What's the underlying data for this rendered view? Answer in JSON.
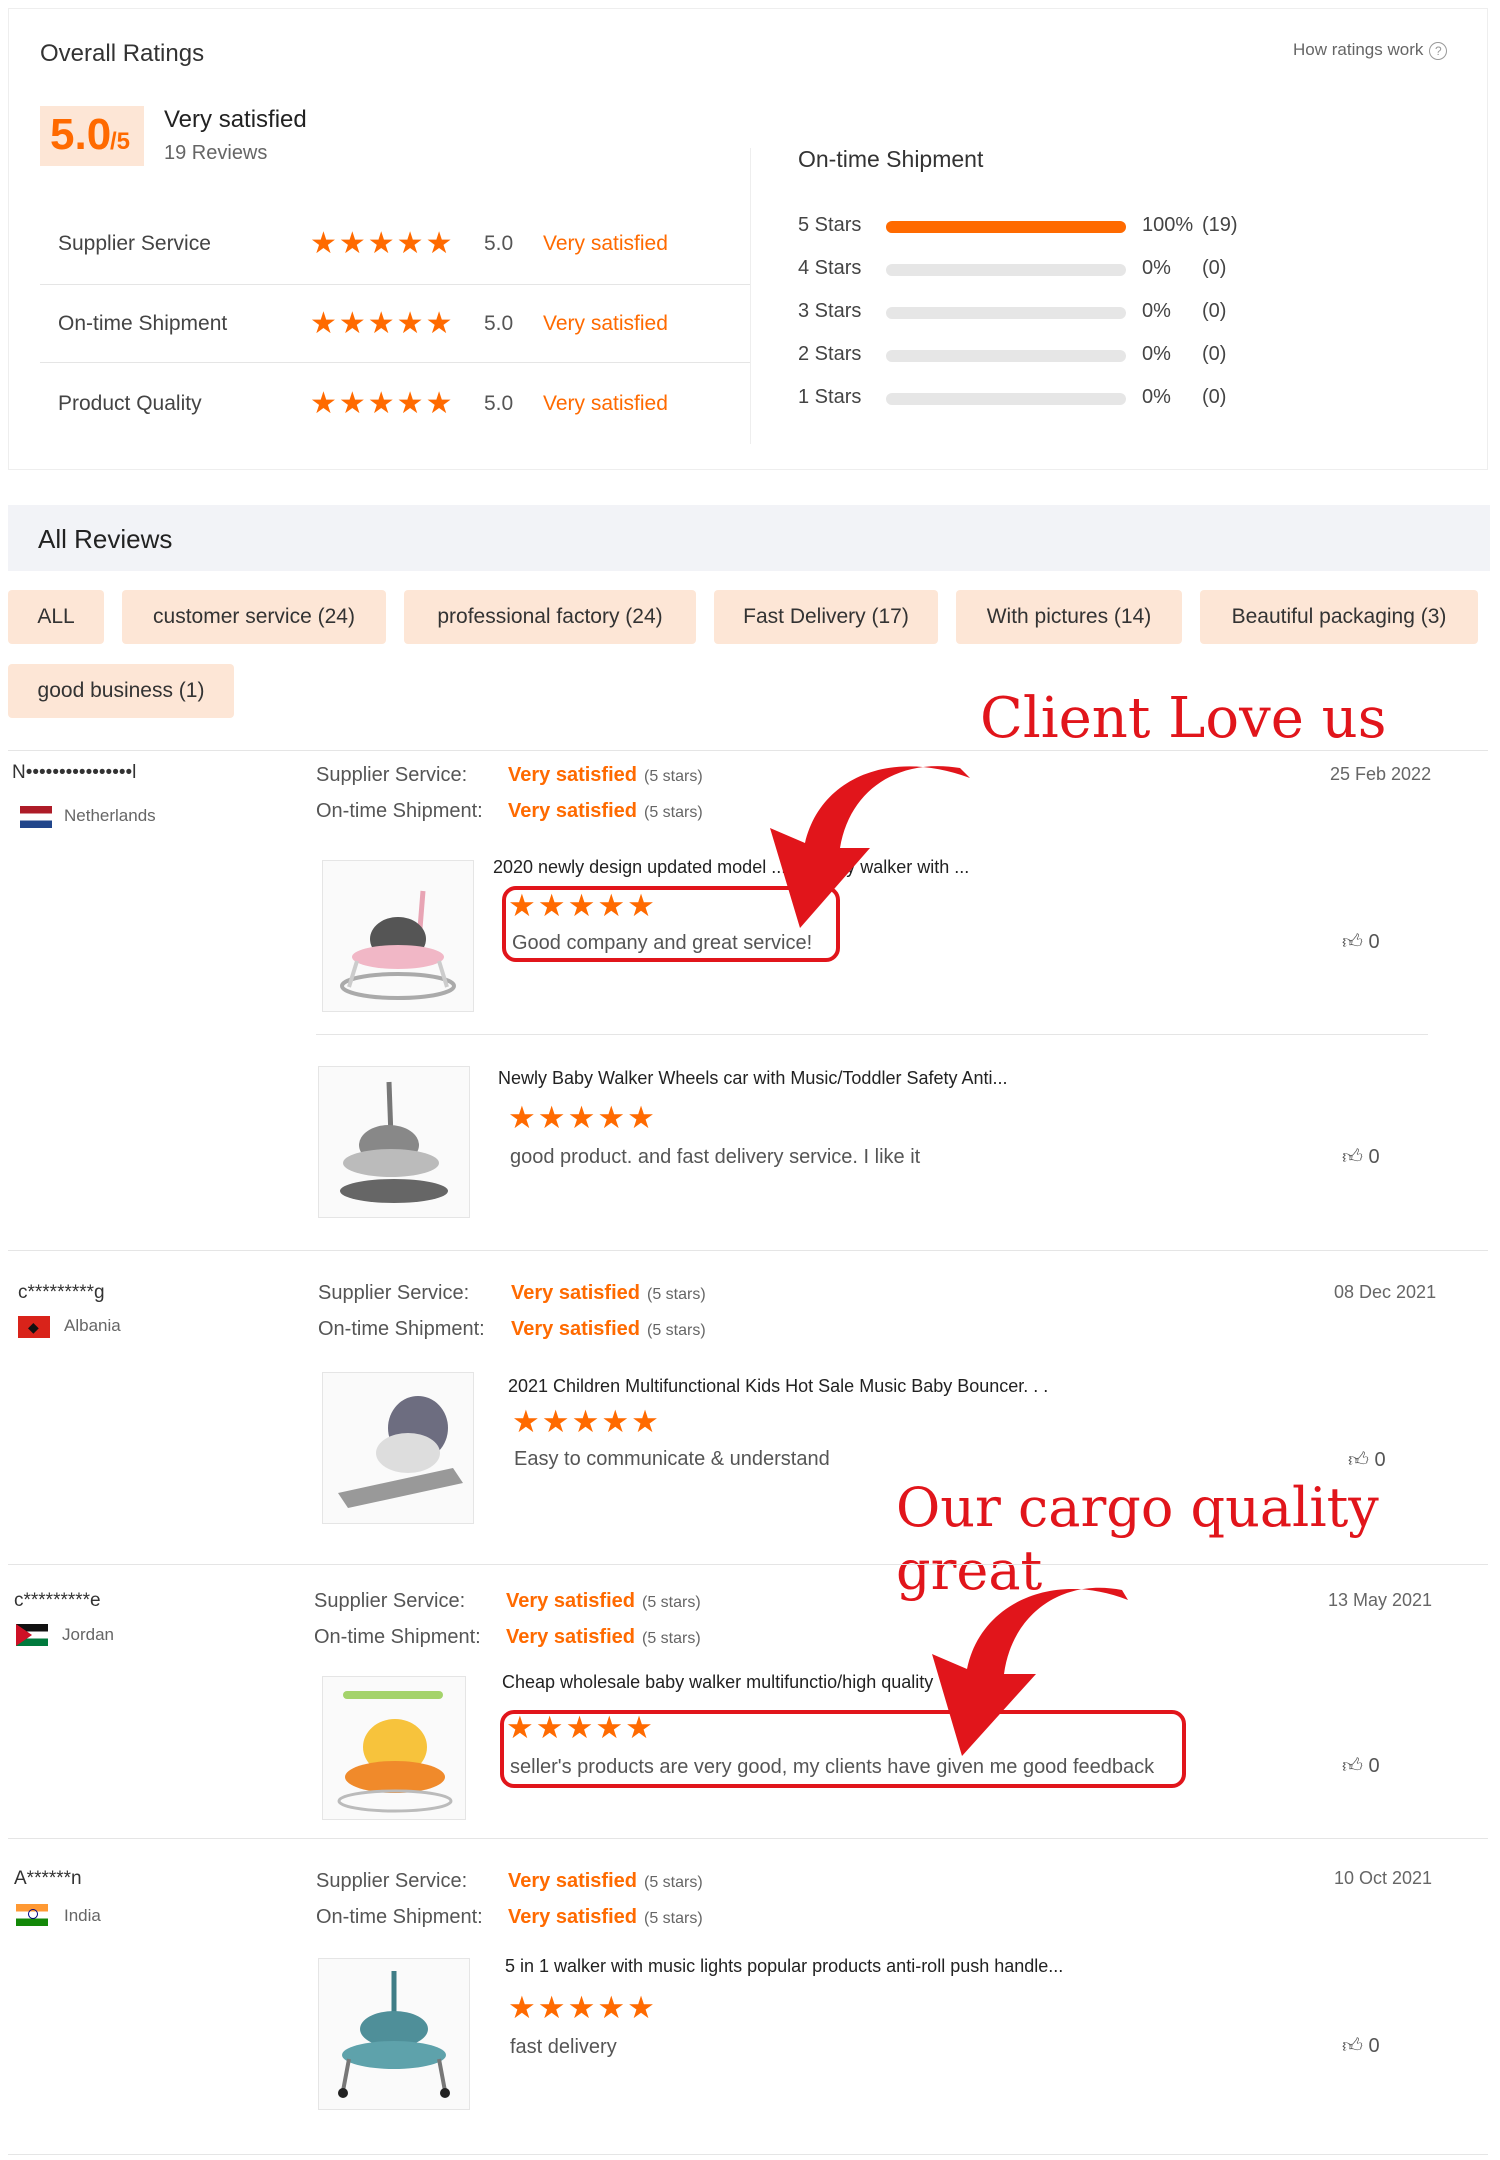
{
  "ratings": {
    "title": "Overall Ratings",
    "help": "How ratings work",
    "score": "5.0",
    "score_out_of": "/5",
    "summary": "Very satisfied",
    "reviews_count": "19 Reviews",
    "rows": [
      {
        "label": "Supplier Service",
        "value": "5.0",
        "status": "Very satisfied"
      },
      {
        "label": "On-time Shipment",
        "value": "5.0",
        "status": "Very satisfied"
      },
      {
        "label": "Product Quality",
        "value": "5.0",
        "status": "Very satisfied"
      }
    ],
    "breakdown_title": "On-time Shipment",
    "breakdown": [
      {
        "label": "5  Stars",
        "fraction": 1.0,
        "pct": "100%",
        "count": "(19)"
      },
      {
        "label": "4  Stars",
        "fraction": 0,
        "pct": "0%",
        "count": "(0)"
      },
      {
        "label": "3  Stars",
        "fraction": 0,
        "pct": "0%",
        "count": "(0)"
      },
      {
        "label": "2  Stars",
        "fraction": 0,
        "pct": "0%",
        "count": "(0)"
      },
      {
        "label": "1  Stars",
        "fraction": 0,
        "pct": "0%",
        "count": "(0)"
      }
    ]
  },
  "all_reviews": {
    "title": "All Reviews",
    "tags": [
      "ALL",
      "customer service (24)",
      "professional factory (24)",
      "Fast Delivery (17)",
      "With pictures (14)",
      "Beautiful packaging (3)",
      "good business (1)"
    ]
  },
  "review_labels": {
    "supplier": "Supplier Service:",
    "shipment": "On-time Shipment:",
    "very_satisfied": "Very satisfied",
    "five_stars": "(5 stars)",
    "stars_glyph": "★★★★★"
  },
  "reviews": [
    {
      "user": "N••••••••••••••••l",
      "country": "Netherlands",
      "date": "25 Feb 2022",
      "items": [
        {
          "title": "2020 newly design updated model ... on baby walker with ...",
          "comment": "Good company and great service!",
          "likes": "0"
        },
        {
          "title": "Newly Baby Walker Wheels car with Music/Toddler Safety Anti...",
          "comment": "good product. and fast delivery service. I like it",
          "likes": "0"
        }
      ]
    },
    {
      "user": "c*********g",
      "country": "Albania",
      "date": "08 Dec 2021",
      "items": [
        {
          "title": "2021 Children Multifunctional Kids Hot Sale Music Baby Bouncer. . .",
          "comment": "Easy to communicate & understand",
          "likes": "0"
        }
      ]
    },
    {
      "user": "c*********e",
      "country": "Jordan",
      "date": "13 May 2021",
      "items": [
        {
          "title": "Cheap wholesale baby walker multifunctio/high quality",
          "comment": "seller's products are very good, my clients have given me good feedback",
          "likes": "0"
        }
      ]
    },
    {
      "user": "A******n",
      "country": "India",
      "date": "10 Oct 2021",
      "items": [
        {
          "title": "5 in 1 walker with music lights popular products anti-roll push handle...",
          "comment": "fast delivery",
          "likes": "0"
        }
      ]
    }
  ],
  "overlays": {
    "client_love": "Client Love us",
    "cargo_quality": "Our cargo quality great"
  },
  "colors": {
    "accent": "#ff6a00",
    "annotation_red": "#e1151b",
    "tag_bg": "#fde6d6"
  }
}
